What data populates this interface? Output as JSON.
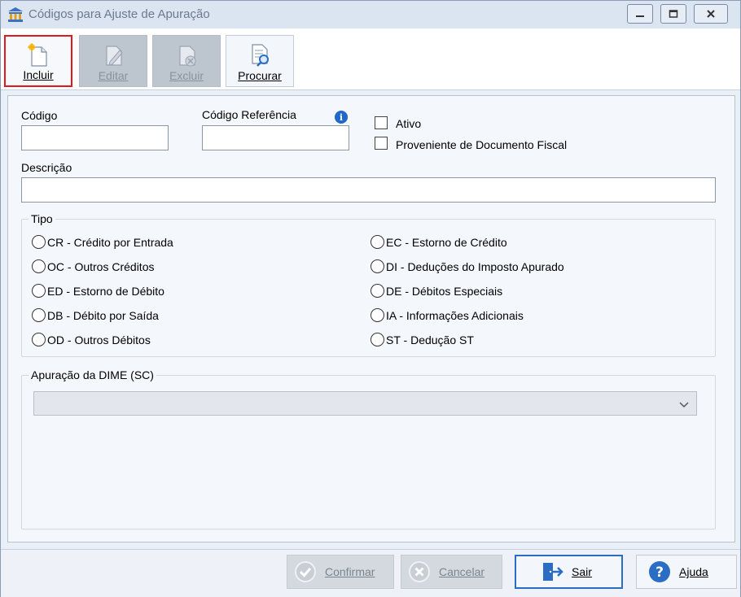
{
  "window": {
    "title": "Códigos para Ajuste de Apuração"
  },
  "toolbar": {
    "incluir": "Incluir",
    "editar": "Editar",
    "excluir": "Excluir",
    "procurar": "Procurar"
  },
  "form": {
    "codigo_label": "Código",
    "codigo_value": "",
    "codigo_ref_label": "Código Referência",
    "codigo_ref_value": "",
    "ativo_label": "Ativo",
    "ativo_checked": false,
    "proveniente_label": "Proveniente de Documento Fiscal",
    "proveniente_checked": false,
    "descricao_label": "Descrição",
    "descricao_value": ""
  },
  "tipo": {
    "title": "Tipo",
    "left": [
      "CR - Crédito por Entrada",
      "OC - Outros Créditos",
      "ED - Estorno de Débito",
      "DB - Débito por Saída",
      "OD - Outros Débitos"
    ],
    "right": [
      "EC - Estorno de Crédito",
      "DI - Deduções do Imposto Apurado",
      "DE - Débitos Especiais",
      "IA - Informações Adicionais",
      "ST - Dedução ST"
    ]
  },
  "dime": {
    "title": "Apuração da DIME (SC)",
    "selected": ""
  },
  "bottom": {
    "confirmar": "Confirmar",
    "cancelar": "Cancelar",
    "sair": "Sair",
    "ajuda": "Ajuda"
  },
  "colors": {
    "accent_blue": "#2b6cc4",
    "selected_red": "#e0191c",
    "info_blue": "#1f67c8"
  },
  "icons": {
    "app": "bank-icon",
    "incluir": "new-document-icon",
    "editar": "edit-document-icon",
    "excluir": "delete-document-icon",
    "procurar": "search-document-icon",
    "confirmar": "check-circle-icon",
    "cancelar": "x-circle-icon",
    "sair": "exit-door-icon",
    "ajuda": "help-circle-icon"
  }
}
